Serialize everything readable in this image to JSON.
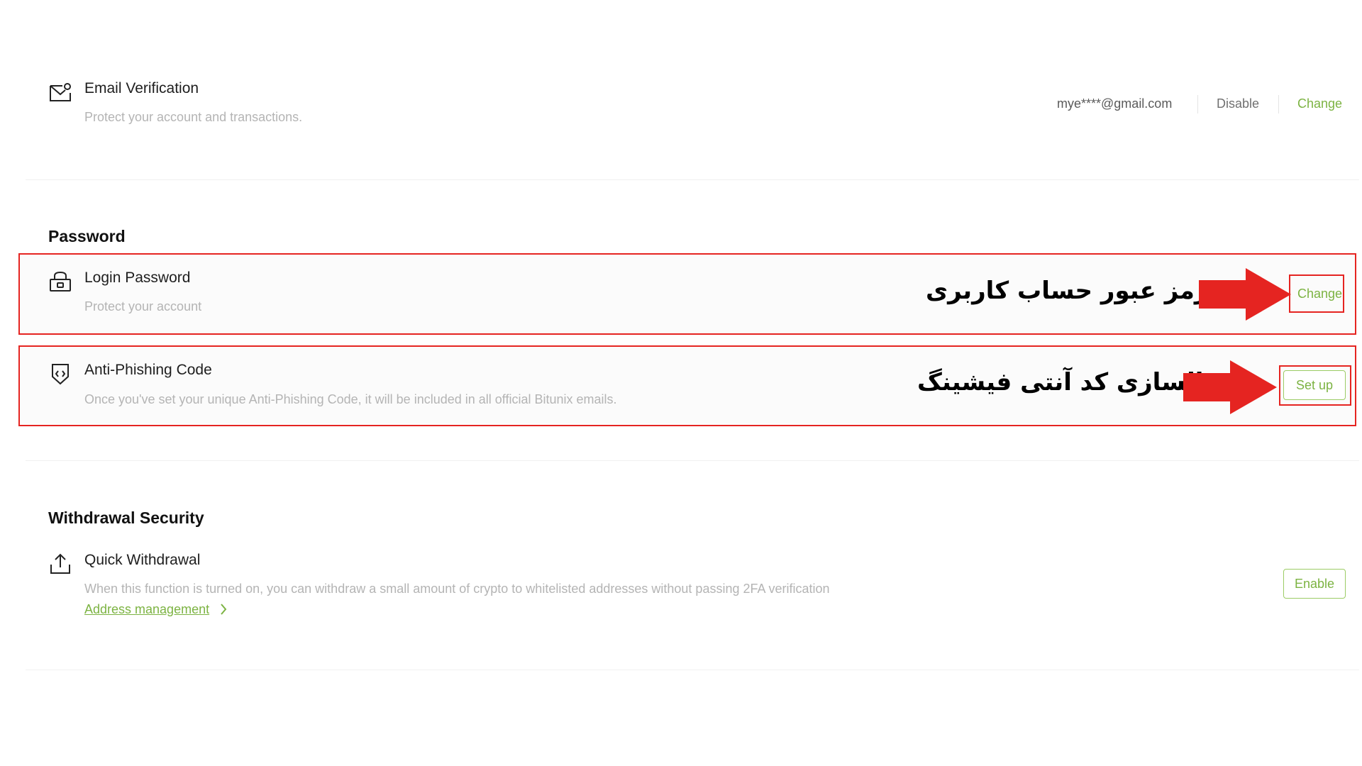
{
  "email_row": {
    "icon": "email-check-icon",
    "title": "Email Verification",
    "description": "Protect your account and transactions.",
    "email_value": "mye****@gmail.com",
    "disable_label": "Disable",
    "change_label": "Change"
  },
  "password_section": {
    "heading": "Password",
    "login_password": {
      "icon": "lock-icon",
      "title": "Login Password",
      "description": "Protect your account",
      "change_label": "Change",
      "annotation": "تغییر رمز عبور حساب کاربری"
    },
    "anti_phishing": {
      "icon": "shield-code-icon",
      "title": "Anti-Phishing Code",
      "description": "Once you've set your unique Anti-Phishing Code, it will be included in all official Bitunix emails.",
      "setup_label": "Set up",
      "annotation": "فعالسازی کد آنتی فیشینگ"
    }
  },
  "withdrawal_section": {
    "heading": "Withdrawal Security",
    "quick_withdrawal": {
      "icon": "upload-icon",
      "title": "Quick Withdrawal",
      "description": "When this function is turned on, you can withdraw a small amount of crypto to whitelisted addresses without passing 2FA verification",
      "link_label": "Address management",
      "enable_label": "Enable"
    }
  },
  "colors": {
    "accent_green": "#7cb342",
    "annotation_red": "#e52421"
  }
}
